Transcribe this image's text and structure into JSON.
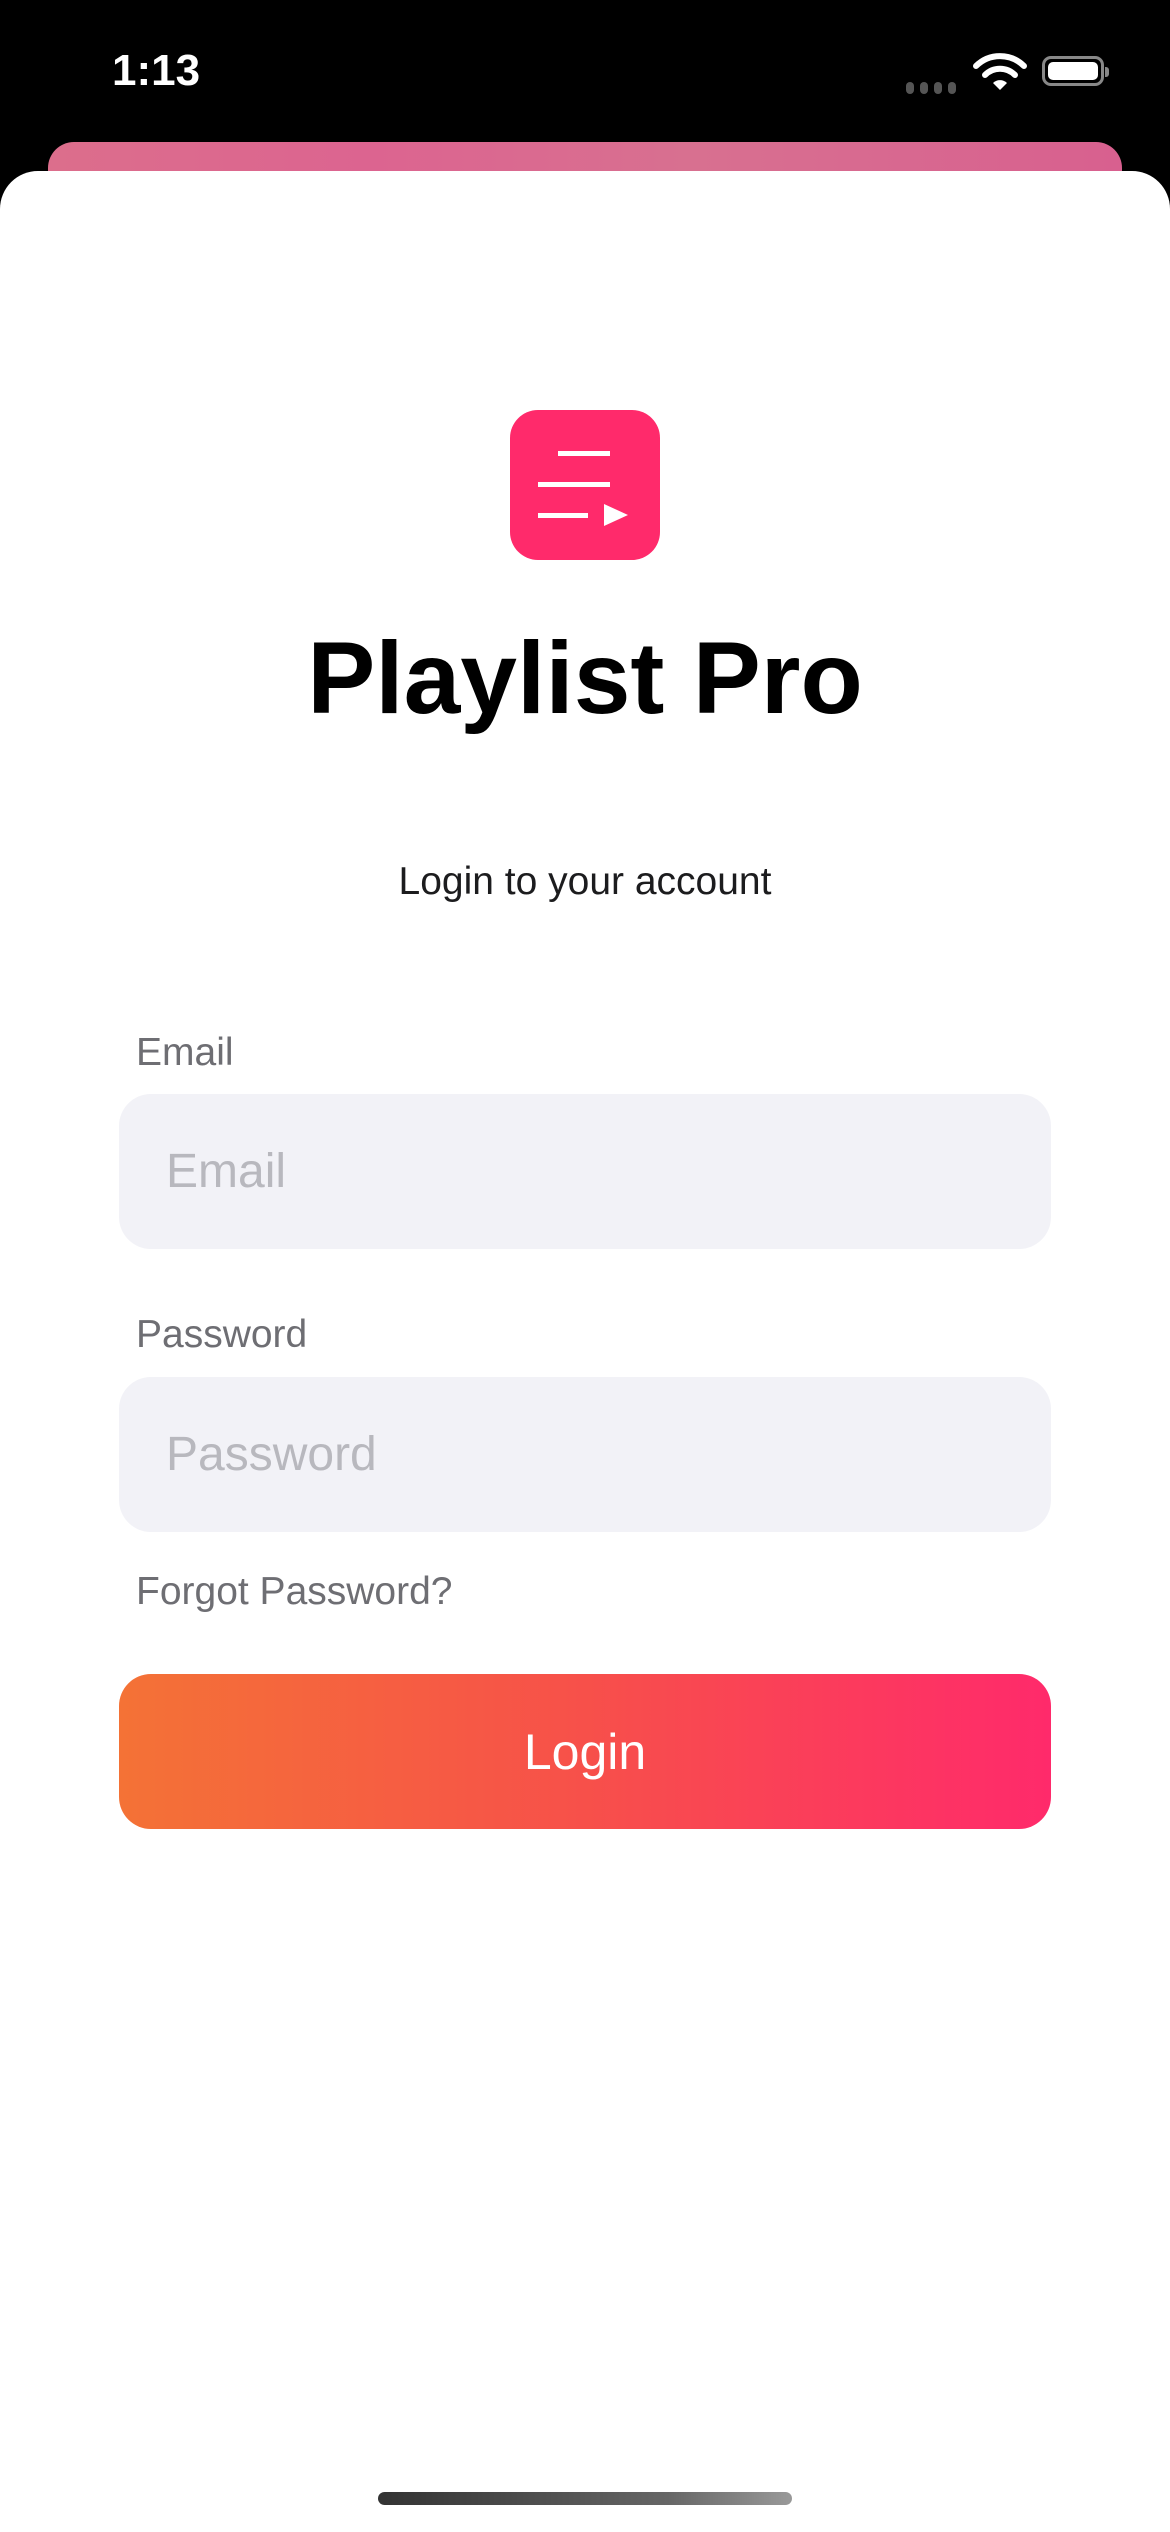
{
  "status_bar": {
    "time": "1:13",
    "icons": [
      "signal-dots-icon",
      "wifi-icon",
      "battery-icon"
    ]
  },
  "app": {
    "title": "Playlist Pro",
    "subtitle": "Login to your account",
    "logo_icon": "playlist-play-icon",
    "brand_color": "#ff2a6b"
  },
  "form": {
    "email": {
      "label": "Email",
      "placeholder": "Email",
      "value": ""
    },
    "password": {
      "label": "Password",
      "placeholder": "Password",
      "value": ""
    },
    "forgot_label": "Forgot Password?",
    "login_label": "Login",
    "login_gradient": [
      "#f47236",
      "#ff2a6b"
    ]
  }
}
